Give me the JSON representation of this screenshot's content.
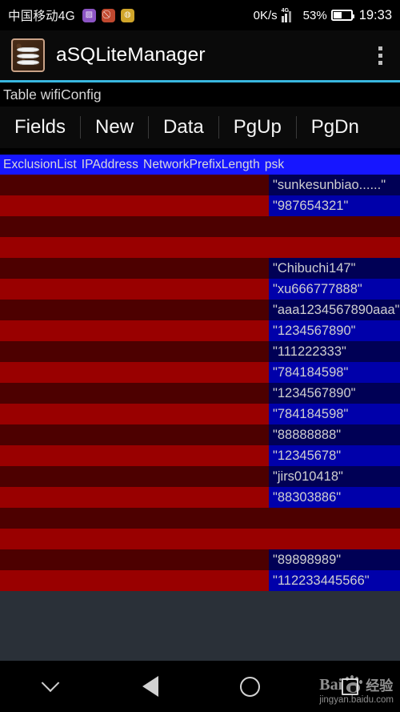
{
  "statusbar": {
    "carrier": "中国移动4G",
    "icons": [
      {
        "name": "photo-icon",
        "glyph": "▨",
        "color": "#8c54c4"
      },
      {
        "name": "mute-icon",
        "glyph": "🔇",
        "color": "#c0492f"
      },
      {
        "name": "cloud-icon",
        "glyph": "◌",
        "color": "#d0a52a"
      }
    ],
    "net_speed": "0K/s",
    "network_type": "4G",
    "battery_percent": "53%",
    "battery_level": 53,
    "time": "19:33"
  },
  "appbar": {
    "title": "aSQLiteManager",
    "icon_name": "asqlitemanager-app-icon",
    "overflow_name": "overflow-menu-button"
  },
  "content": {
    "table_label": "Table wifiConfig",
    "buttons": [
      {
        "label": "Fields",
        "name": "fields-button"
      },
      {
        "label": "New",
        "name": "new-button"
      },
      {
        "label": "Data",
        "name": "data-button"
      },
      {
        "label": "PgUp",
        "name": "pgup-button"
      },
      {
        "label": "PgDn",
        "name": "pgdn-button"
      }
    ],
    "columns": [
      "ExclusionList",
      "IPAddress",
      "NetworkPrefixLength",
      "psk"
    ],
    "rows": [
      {
        "psk": "\"sunkesunbiao......\""
      },
      {
        "psk": "\"987654321\""
      },
      {
        "psk": ""
      },
      {
        "psk": ""
      },
      {
        "psk": "\"Chibuchi147\""
      },
      {
        "psk": "\"xu666777888\""
      },
      {
        "psk": "\"aaa1234567890aaa\""
      },
      {
        "psk": "\"1234567890\""
      },
      {
        "psk": "\"111222333\""
      },
      {
        "psk": "\"784184598\""
      },
      {
        "psk": "\"1234567890\""
      },
      {
        "psk": "\"784184598\""
      },
      {
        "psk": "\"88888888\""
      },
      {
        "psk": "\"12345678\""
      },
      {
        "psk": "\"jirs010418\""
      },
      {
        "psk": "\"88303886\""
      },
      {
        "psk": ""
      },
      {
        "psk": ""
      },
      {
        "psk": "\"89898989\""
      },
      {
        "psk": "\"112233445566\""
      }
    ]
  },
  "navbar": {
    "items": [
      {
        "name": "hide-navbar-chevron-icon"
      },
      {
        "name": "back-button-icon"
      },
      {
        "name": "home-button-icon"
      },
      {
        "name": "recents-button-icon"
      }
    ],
    "watermark": {
      "brand": "Bai",
      "suffix": "经验",
      "url": "jingyan.baidu.com"
    }
  },
  "colors": {
    "accent": "#39b7e0",
    "header_blue": "#1616ff",
    "row_red_dark": "#4d0000",
    "row_red_light": "#990000",
    "psk_blue_dark": "#000055",
    "psk_blue_light": "#0000aa",
    "page_bg": "#2a3038"
  }
}
